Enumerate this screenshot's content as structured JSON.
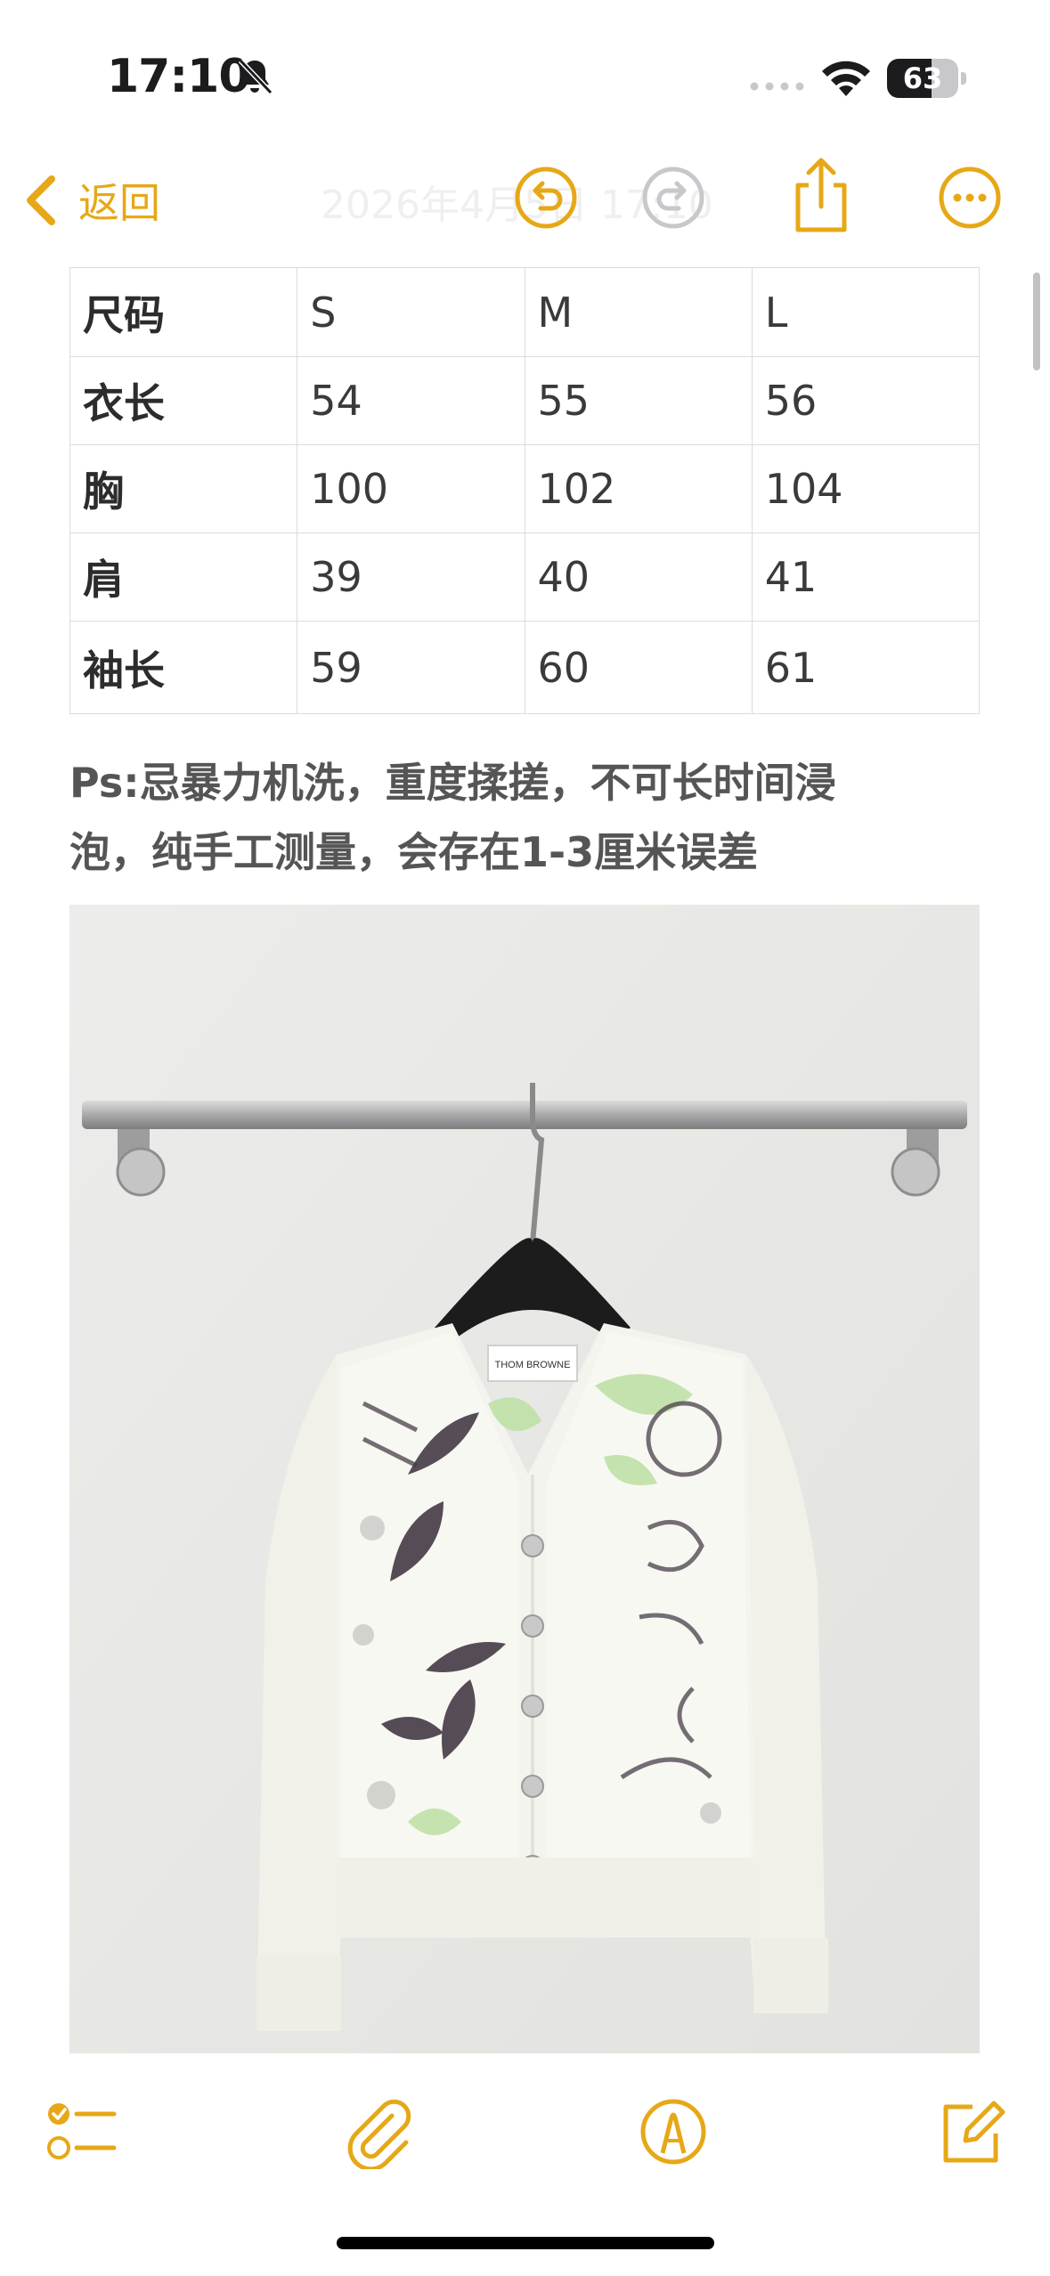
{
  "status_bar": {
    "time": "17:10",
    "battery_level": "63",
    "battery_fraction": 0.63,
    "icons": [
      "bell-slash-icon",
      "signal-dots-icon",
      "wifi-icon",
      "battery-icon"
    ]
  },
  "nav": {
    "back_label": "返回",
    "title": "2026年4月5日 17:10",
    "icons": [
      "chevron-left-icon",
      "undo-icon",
      "redo-icon",
      "share-icon",
      "more-icon"
    ]
  },
  "accent_color": "#e6a817",
  "size_table": {
    "header": [
      "尺码",
      "S",
      "M",
      "L"
    ],
    "rows": [
      [
        "衣长",
        "54",
        "55",
        "56"
      ],
      [
        "胸",
        "100",
        "102",
        "104"
      ],
      [
        "肩",
        "39",
        "40",
        "41"
      ],
      [
        "袖长",
        "59",
        "60",
        "61"
      ]
    ]
  },
  "note": {
    "line1": "Ps:忌暴力机洗，重度揉搓，不可长时间浸",
    "line2": "泡，纯手工测量，会存在1-3厘米误差"
  },
  "photo": {
    "subject": "cardigan-photo",
    "tag_text": "THOM BROWNE"
  },
  "toolbar": {
    "icons": [
      "checklist-icon",
      "paperclip-icon",
      "markup-icon",
      "compose-icon"
    ]
  }
}
